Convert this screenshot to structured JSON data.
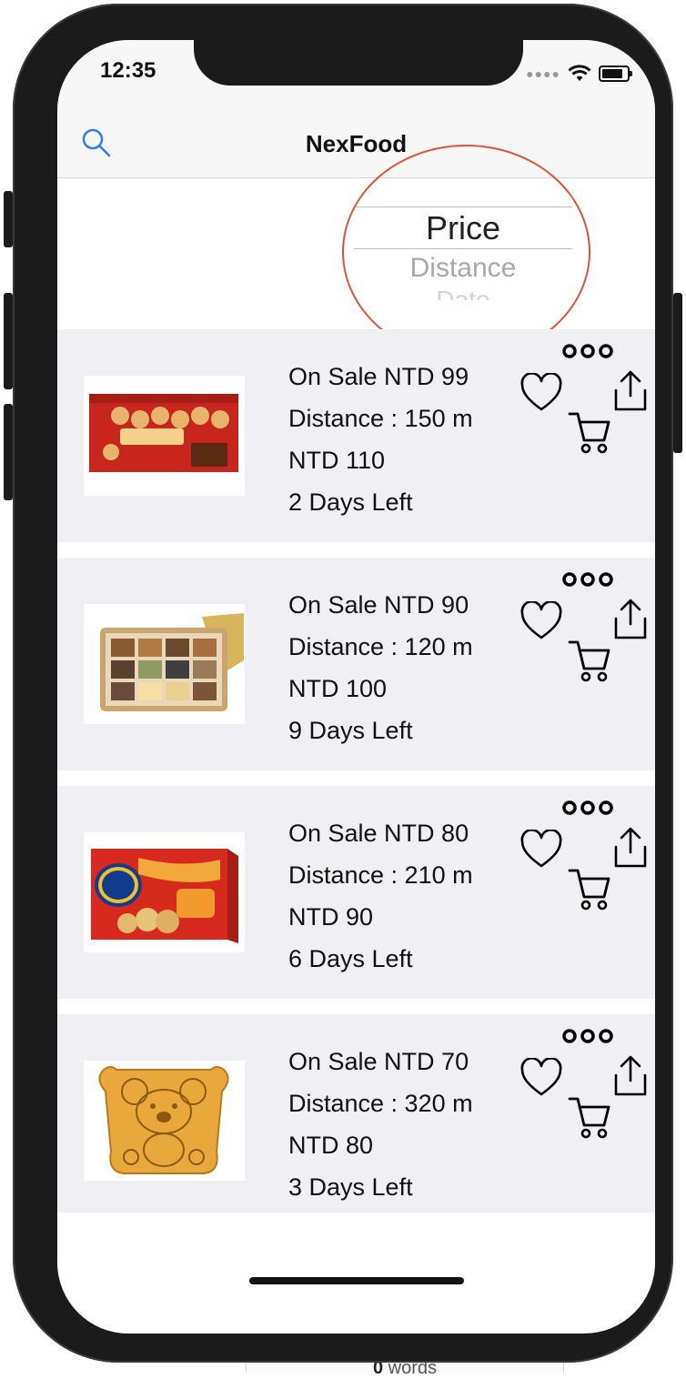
{
  "status_bar": {
    "time": "12:35"
  },
  "nav": {
    "title": "NexFood"
  },
  "sort_picker": {
    "options": [
      "Price",
      "Distance",
      "Date"
    ]
  },
  "items": [
    {
      "sale": "On Sale NTD 99",
      "distance": "Distance : 150 m",
      "price": "NTD 110",
      "days": "2 Days Left",
      "image": "choco-puff-box"
    },
    {
      "sale": "On Sale NTD 90",
      "distance": "Distance : 120 m",
      "price": "NTD 100",
      "days": "9 Days Left",
      "image": "assorted-cake-box"
    },
    {
      "sale": "On Sale NTD 80",
      "distance": "Distance : 210 m",
      "price": "NTD 90",
      "days": "6 Days Left",
      "image": "ritz-cracker-box"
    },
    {
      "sale": "On Sale NTD 70",
      "distance": "Distance : 320 m",
      "price": "NTD 80",
      "days": "3 Days Left",
      "image": "koala-biscuit"
    }
  ],
  "footer": {
    "word_count": "0",
    "word_label": "words"
  },
  "colors": {
    "accent": "#2f7cf6",
    "highlight": "#e0533a",
    "row_bg": "#efeff4"
  }
}
